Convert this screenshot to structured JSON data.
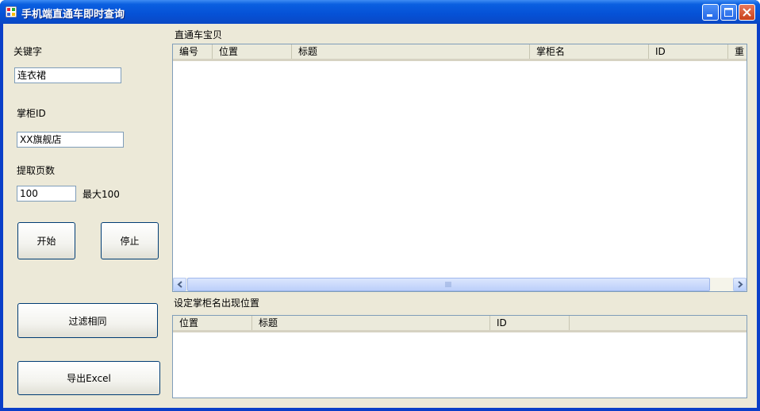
{
  "window": {
    "title": "手机端直通车即时查询"
  },
  "form": {
    "keyword_label": "关键字",
    "keyword_value": "连衣裙",
    "shop_id_label": "掌柜ID",
    "shop_id_value": "XX旗舰店",
    "pages_label": "提取页数",
    "pages_value": "100",
    "pages_max_hint": "最大100",
    "start_button": "开始",
    "stop_button": "停止",
    "filter_button": "过滤相同",
    "export_button": "导出Excel"
  },
  "results": {
    "group_label": "直通车宝贝",
    "columns": [
      "编号",
      "位置",
      "标题",
      "掌柜名",
      "ID",
      "重"
    ]
  },
  "positions": {
    "group_label": "设定掌柜名出现位置",
    "columns": [
      "位置",
      "标题",
      "ID"
    ]
  },
  "colors": {
    "titlebar": "#0a5fe0",
    "client_bg": "#ece9d8",
    "close_button": "#c9401a"
  }
}
